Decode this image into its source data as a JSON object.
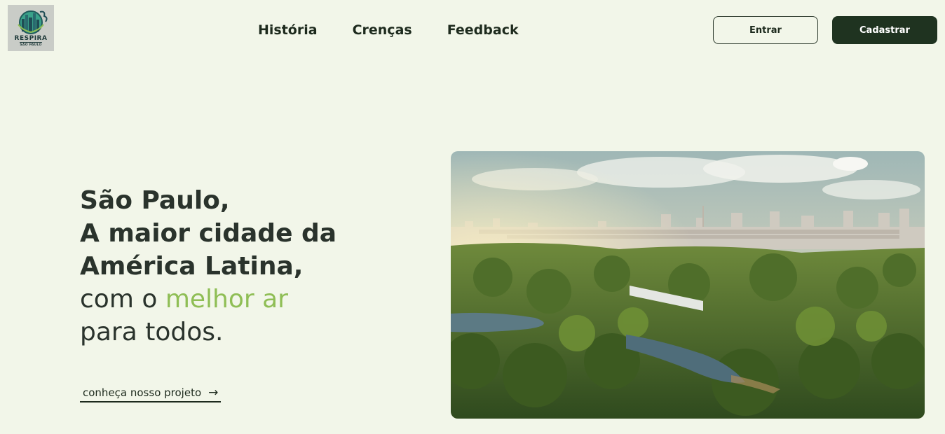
{
  "logo": {
    "title": "RESPIRA",
    "subtitle": "SÃO PAULO"
  },
  "nav": {
    "items": [
      "História",
      "Crenças",
      "Feedback"
    ]
  },
  "auth": {
    "login_label": "Entrar",
    "signup_label": "Cadastrar"
  },
  "hero": {
    "line1": "São Paulo,",
    "line2": "A maior cidade da",
    "line3": "América Latina,",
    "line4_prefix": "com o ",
    "line4_accent": "melhor ar",
    "line5": "para todos.",
    "cta_label": "conheça nosso projeto",
    "cta_arrow": "→"
  },
  "colors": {
    "background": "#f2f6e9",
    "accent": "#8fbe55",
    "primary_dark": "#1f3320"
  }
}
